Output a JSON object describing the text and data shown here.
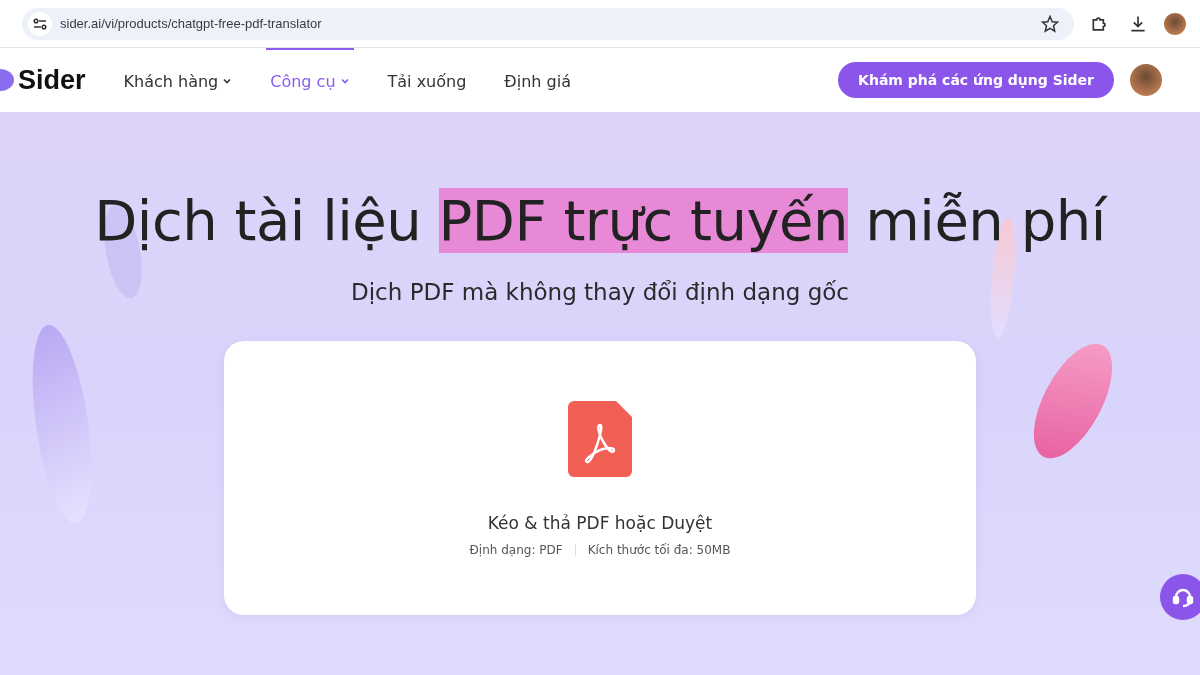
{
  "browser": {
    "url": "sider.ai/vi/products/chatgpt-free-pdf-translator"
  },
  "nav": {
    "logo": "Sider",
    "items": [
      {
        "label": "Khách hàng",
        "dropdown": true,
        "selected": false
      },
      {
        "label": "Công cụ",
        "dropdown": true,
        "selected": true
      },
      {
        "label": "Tải xuống",
        "dropdown": false,
        "selected": false
      },
      {
        "label": "Định giá",
        "dropdown": false,
        "selected": false
      }
    ],
    "cta": "Khám phá các ứng dụng Sider"
  },
  "hero": {
    "heading": [
      {
        "text": "Dịch tài liệu ",
        "highlighted": false
      },
      {
        "text": "PDF trực tuyến",
        "highlighted": true
      },
      {
        "text": " miễn phí",
        "highlighted": false
      }
    ],
    "subtitle": "Dịch PDF mà không thay đổi định dạng gốc"
  },
  "upload": {
    "prompt": "Kéo & thả PDF hoặc Duyệt",
    "format": "Định dạng: PDF",
    "max_size": "Kích thước tối đa: 50MB"
  }
}
